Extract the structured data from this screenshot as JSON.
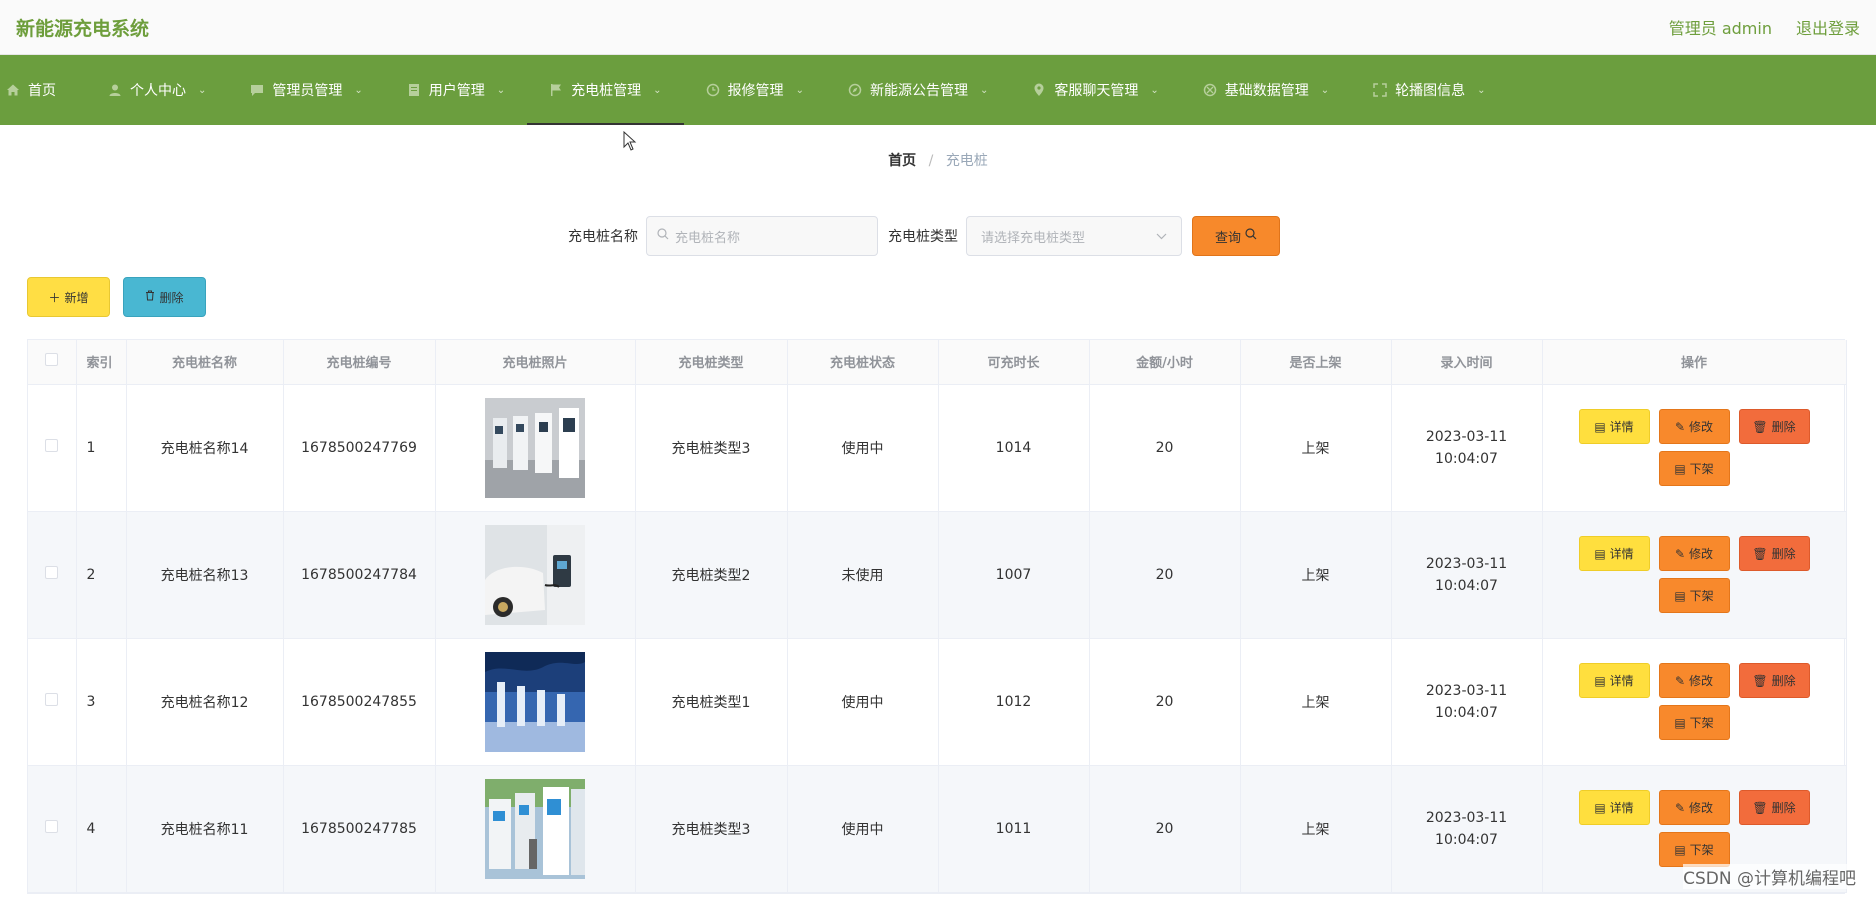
{
  "app": {
    "title": "新能源充电系统"
  },
  "top_right": {
    "user": "管理员 admin",
    "logout": "退出登录"
  },
  "nav": [
    {
      "label": "首页",
      "icon": "home-icon",
      "chevron": false
    },
    {
      "label": "个人中心",
      "icon": "user-icon",
      "chevron": true
    },
    {
      "label": "管理员管理",
      "icon": "chat-icon",
      "chevron": true
    },
    {
      "label": "用户管理",
      "icon": "document-icon",
      "chevron": true
    },
    {
      "label": "充电桩管理",
      "icon": "flag-icon",
      "chevron": true,
      "active": true
    },
    {
      "label": "报修管理",
      "icon": "clock-icon",
      "chevron": true
    },
    {
      "label": "新能源公告管理",
      "icon": "compass-icon",
      "chevron": true
    },
    {
      "label": "客服聊天管理",
      "icon": "location-icon",
      "chevron": true
    },
    {
      "label": "基础数据管理",
      "icon": "settings-icon",
      "chevron": true
    },
    {
      "label": "轮播图信息",
      "icon": "fullscreen-icon",
      "chevron": true
    }
  ],
  "breadcrumb": {
    "home": "首页",
    "separator": "/",
    "current": "充电桩"
  },
  "search": {
    "name_label": "充电桩名称",
    "name_placeholder": "充电桩名称",
    "type_label": "充电桩类型",
    "type_placeholder": "请选择充电桩类型",
    "query_label": "查询"
  },
  "actions": {
    "add_label": "新增",
    "delete_label": "删除"
  },
  "table": {
    "headers": [
      "索引",
      "充电桩名称",
      "充电桩编号",
      "充电桩照片",
      "充电桩类型",
      "充电桩状态",
      "可充时长",
      "金额/小时",
      "是否上架",
      "录入时间",
      "操作"
    ],
    "op_labels": {
      "detail": "详情",
      "edit": "修改",
      "delete": "删除",
      "offshelf": "下架"
    },
    "rows": [
      {
        "index": "1",
        "name": "充电桩名称14",
        "code": "1678500247769",
        "type": "充电桩类型3",
        "status": "使用中",
        "duration": "1014",
        "price": "20",
        "shelf": "上架",
        "time": "2023-03-11 10:04:07"
      },
      {
        "index": "2",
        "name": "充电桩名称13",
        "code": "1678500247784",
        "type": "充电桩类型2",
        "status": "未使用",
        "duration": "1007",
        "price": "20",
        "shelf": "上架",
        "time": "2023-03-11 10:04:07"
      },
      {
        "index": "3",
        "name": "充电桩名称12",
        "code": "1678500247855",
        "type": "充电桩类型1",
        "status": "使用中",
        "duration": "1012",
        "price": "20",
        "shelf": "上架",
        "time": "2023-03-11 10:04:07"
      },
      {
        "index": "4",
        "name": "充电桩名称11",
        "code": "1678500247785",
        "type": "充电桩类型3",
        "status": "使用中",
        "duration": "1011",
        "price": "20",
        "shelf": "上架",
        "time": "2023-03-11 10:04:07"
      }
    ]
  },
  "watermark": "CSDN @计算机编程吧",
  "colors": {
    "nav_bg": "#6b9e3e",
    "brand_text": "#6e9e3c",
    "query_btn": "#f7892b",
    "add_btn": "#ffde44",
    "delete_btn": "#49b7d2"
  }
}
